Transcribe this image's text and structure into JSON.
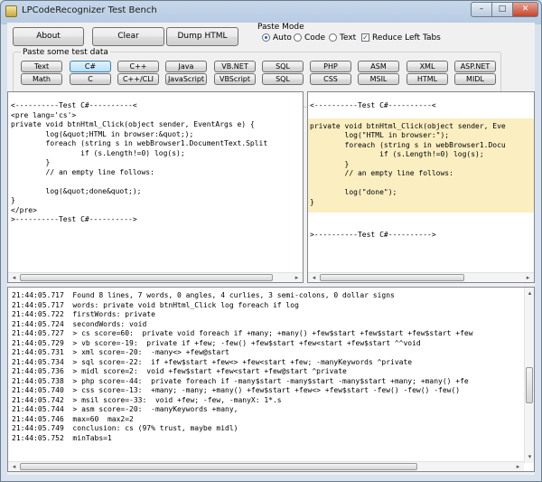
{
  "window": {
    "title": "LPCodeRecognizer Test Bench",
    "controls": {
      "minimize": "–",
      "maximize": "□",
      "close": "✕"
    }
  },
  "toolbar": {
    "about": "About",
    "clear": "Clear",
    "dump_html": "Dump HTML"
  },
  "paste_mode": {
    "label": "Paste Mode",
    "options": [
      "Auto",
      "Code",
      "Text"
    ],
    "selected": "Auto",
    "reduce_left_tabs": "Reduce Left Tabs",
    "reduce_checked": true
  },
  "test_data": {
    "label": "Paste some test data",
    "row1": [
      "Text",
      "C#",
      "C++",
      "Java",
      "VB.NET",
      "SQL",
      "PHP",
      "ASM",
      "XML",
      "ASP.NET"
    ],
    "row2": [
      "Math",
      "C",
      "C++/CLI",
      "JavaScript",
      "VBScript",
      "SQL",
      "CSS",
      "MSIL",
      "HTML",
      "MIDL"
    ],
    "selected": "C#"
  },
  "left_pane": {
    "text": "<----------Test C#----------<\n<pre lang='cs'>\nprivate void btnHtml_Click(object sender, EventArgs e) {\n        log(&quot;HTML in browser:&quot;);\n        foreach (string s in webBrowser1.DocumentText.Split\n                if (s.Length!=0) log(s);\n        }\n        // an empty line follows:\n\n        log(&quot;done&quot;);\n}\n</pre>\n>----------Test C#---------->"
  },
  "right_pane": {
    "header": "<----------Test C#----------<",
    "highlight": "private void btnHtml_Click(object sender, Eve\n        log(\"HTML in browser:\");\n        foreach (string s in webBrowser1.Docu\n                if (s.Length!=0) log(s);\n        }\n        // an empty line follows:\n\n        log(\"done\");\n}",
    "footer": ">----------Test C#---------->"
  },
  "log": {
    "text": "21:44:05.717  Found 8 lines, 7 words, 0 angles, 4 curlies, 3 semi-colons, 0 dollar signs\n21:44:05.717  words: private void btnHtml_Click log foreach if log\n21:44:05.722  firstWords: private\n21:44:05.724  secondWords: void\n21:44:05.727  > cs score=60:  private void foreach if +many; +many() +few$start +few$start +few$start +few\n21:44:05.729  > vb score=-19:  private if +few; -few() +few$start +few<start +few$start ^^void\n21:44:05.731  > xml score=-20:  -many<> +few@start\n21:44:05.734  > sql score=-22:  if +few$start +few<> +few<start +few; -manyKeywords ^private\n21:44:05.736  > midl score=2:  void +few$start +few<start +few@start ^private\n21:44:05.738  > php score=-44:  private foreach if -many$start -many$start -many$start +many; +many() +fe\n21:44:05.740  > css score=-13:  +many; -many; +many() +few$start +few<> +few$start -few() -few() -few()\n21:44:05.742  > msil score=-33:  void +few; -few, -manyX: 1*.s\n21:44:05.744  > asm score=-20:  -manyKeywords +many,\n21:44:05.746  max=60  max2=2\n21:44:05.749  conclusion: cs (97% trust, maybe midl)\n21:44:05.752  minTabs=1"
  },
  "scrollbar": {
    "left_arrow": "◂",
    "right_arrow": "▸",
    "up_arrow": "▴",
    "down_arrow": "▾"
  },
  "colors": {
    "highlight": "#fbefc2",
    "selected_button": "#b7dff9",
    "window_frame": "#b7cbe1"
  }
}
